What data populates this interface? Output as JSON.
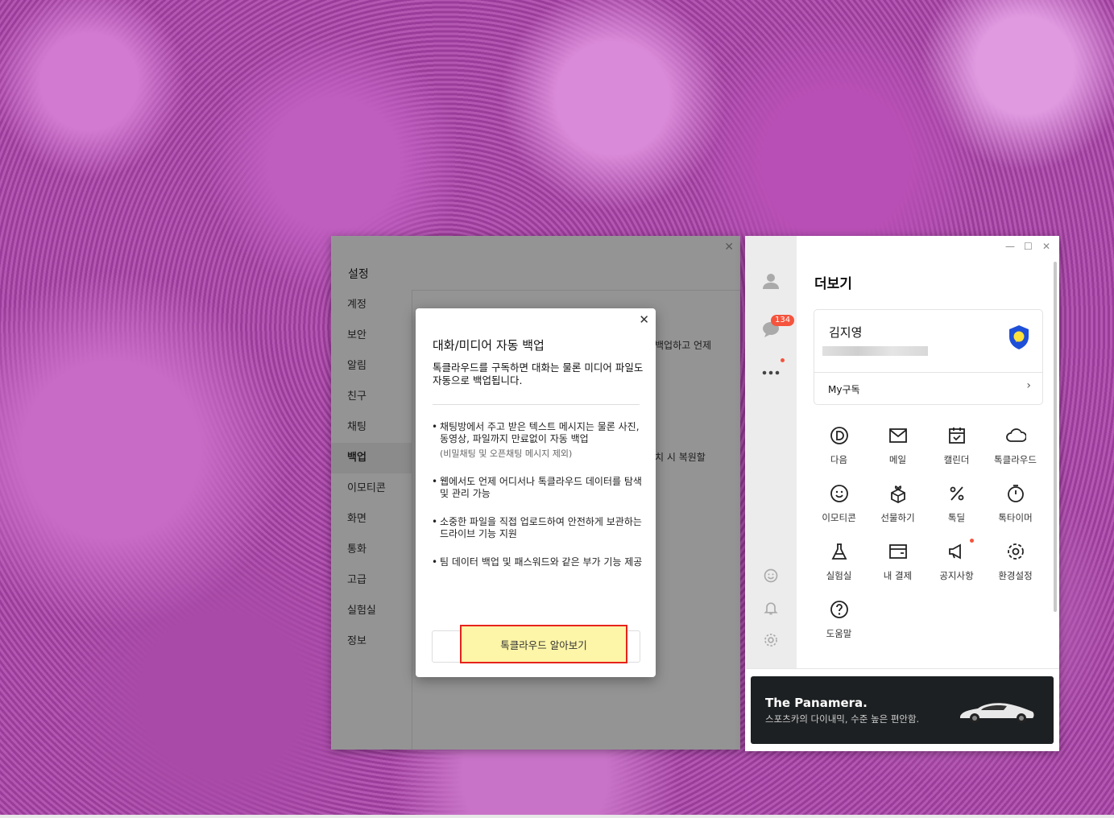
{
  "settings": {
    "title": "설정",
    "close_icon": "✕",
    "nav": [
      "계정",
      "보안",
      "알림",
      "친구",
      "채팅",
      "백업",
      "이모티콘",
      "화면",
      "통화",
      "고급",
      "실험실",
      "정보"
    ],
    "active_nav": "백업",
    "text1": "백업하고 언제",
    "text2": "치 시 복원할"
  },
  "dialog": {
    "title": "대화/미디어 자동 백업",
    "subtitle": "톡클라우드를 구독하면 대화는 물론 미디어 파일도 자동으로 백업됩니다.",
    "bullets": [
      {
        "text": "채팅방에서 주고 받은 텍스트 메시지는 물론 사진, 동영상, 파일까지 만료없이 자동 백업",
        "note": "(비밀채팅 및 오픈채팅 메시지 제외)"
      },
      {
        "text": "웹에서도 언제 어디서나 톡클라우드 데이터를 탐색 및 관리 가능",
        "note": ""
      },
      {
        "text": "소중한 파일을 직접 업로드하여 안전하게 보관하는 드라이브 기능 지원",
        "note": ""
      },
      {
        "text": "팀 데이터 백업 및 패스워드와 같은 부가 기능 제공",
        "note": ""
      }
    ],
    "bullet_symbol": "•",
    "button_label": "톡클라우드 알아보기",
    "close_icon": "✕"
  },
  "kakao": {
    "title": "더보기",
    "badge_count": "134",
    "profile": {
      "name": "김지영",
      "sub_label": "My구독",
      "chevron": "›"
    },
    "window_controls": [
      "—",
      "☐",
      "✕"
    ],
    "grid": [
      {
        "label": "다음",
        "icon": "daum-icon"
      },
      {
        "label": "메일",
        "icon": "mail-icon"
      },
      {
        "label": "캘린더",
        "icon": "calendar-icon"
      },
      {
        "label": "톡클라우드",
        "icon": "cloud-icon"
      },
      {
        "label": "이모티콘",
        "icon": "emoticon-icon"
      },
      {
        "label": "선물하기",
        "icon": "gift-icon"
      },
      {
        "label": "톡딜",
        "icon": "discount-icon"
      },
      {
        "label": "톡타이머",
        "icon": "timer-icon"
      },
      {
        "label": "실험실",
        "icon": "flask-icon"
      },
      {
        "label": "내 결제",
        "icon": "wallet-icon"
      },
      {
        "label": "공지사항",
        "icon": "megaphone-icon"
      },
      {
        "label": "환경설정",
        "icon": "settings-icon"
      },
      {
        "label": "도움말",
        "icon": "help-icon"
      }
    ],
    "ad": {
      "title": "The Panamera.",
      "subtitle": "스포츠카의 다이내믹, 수준 높은 편안함."
    },
    "colors": {
      "badge": "#f5533d",
      "highlight_border": "#e6231c",
      "button_bg": "#fdf5a7",
      "shield": "#1e4fd8",
      "shield_inner": "#fde13a"
    }
  }
}
